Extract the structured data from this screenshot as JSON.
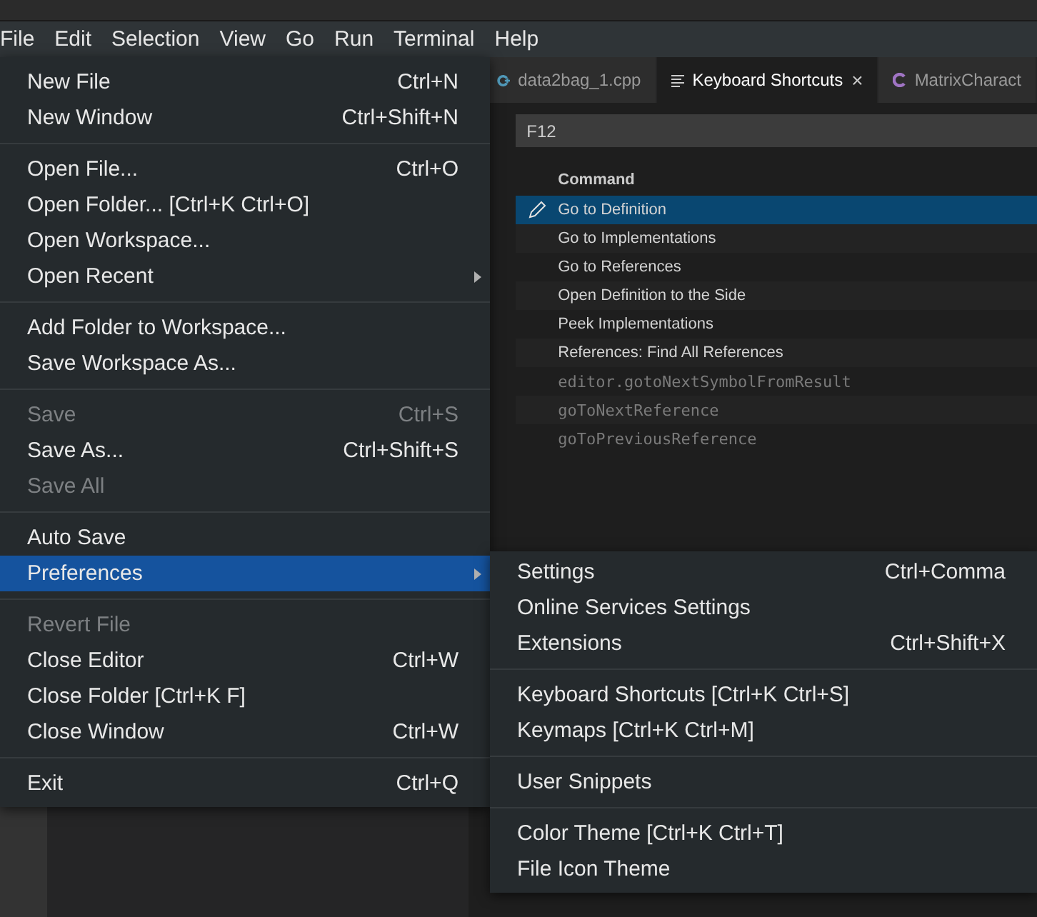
{
  "menubar": [
    {
      "label": "File"
    },
    {
      "label": "Edit"
    },
    {
      "label": "Selection"
    },
    {
      "label": "View"
    },
    {
      "label": "Go"
    },
    {
      "label": "Run"
    },
    {
      "label": "Terminal"
    },
    {
      "label": "Help"
    }
  ],
  "tabs": [
    {
      "label": "data2bag_1.cpp",
      "kind": "cpp",
      "selected": false
    },
    {
      "label": "Keyboard Shortcuts",
      "kind": "keybindings",
      "selected": true,
      "close": "×"
    },
    {
      "label": "MatrixCharact",
      "kind": "c",
      "selected": false
    }
  ],
  "search": {
    "value": "F12"
  },
  "table": {
    "columns": [
      "Command"
    ],
    "rows": [
      {
        "command": "Go to Definition",
        "kind": "label",
        "selected": true
      },
      {
        "command": "Go to Implementations",
        "kind": "label",
        "selected": false
      },
      {
        "command": "Go to References",
        "kind": "label",
        "selected": false
      },
      {
        "command": "Open Definition to the Side",
        "kind": "label",
        "selected": false
      },
      {
        "command": "Peek Implementations",
        "kind": "label",
        "selected": false
      },
      {
        "command": "References: Find All References",
        "kind": "label",
        "selected": false
      },
      {
        "command": "editor.gotoNextSymbolFromResult",
        "kind": "id",
        "selected": false
      },
      {
        "command": "goToNextReference",
        "kind": "id",
        "selected": false
      },
      {
        "command": "goToPreviousReference",
        "kind": "id",
        "selected": false
      }
    ]
  },
  "file_menu": {
    "groups": [
      [
        {
          "label": "New File",
          "shortcut": "Ctrl+N",
          "disabled": false,
          "selected": false,
          "submenu": false
        },
        {
          "label": "New Window",
          "shortcut": "Ctrl+Shift+N",
          "disabled": false,
          "selected": false,
          "submenu": false
        }
      ],
      [
        {
          "label": "Open File...",
          "shortcut": "Ctrl+O",
          "disabled": false,
          "selected": false,
          "submenu": false
        },
        {
          "label": "Open Folder... [Ctrl+K Ctrl+O]",
          "disabled": false,
          "selected": false,
          "submenu": false
        },
        {
          "label": "Open Workspace...",
          "disabled": false,
          "selected": false,
          "submenu": false
        },
        {
          "label": "Open Recent",
          "disabled": false,
          "selected": false,
          "submenu": true
        }
      ],
      [
        {
          "label": "Add Folder to Workspace...",
          "disabled": false,
          "selected": false,
          "submenu": false
        },
        {
          "label": "Save Workspace As...",
          "disabled": false,
          "selected": false,
          "submenu": false
        }
      ],
      [
        {
          "label": "Save",
          "shortcut": "Ctrl+S",
          "disabled": true,
          "selected": false,
          "submenu": false
        },
        {
          "label": "Save As...",
          "shortcut": "Ctrl+Shift+S",
          "disabled": false,
          "selected": false,
          "submenu": false
        },
        {
          "label": "Save All",
          "disabled": true,
          "selected": false,
          "submenu": false
        }
      ],
      [
        {
          "label": "Auto Save",
          "disabled": false,
          "selected": false,
          "submenu": false
        },
        {
          "label": "Preferences",
          "disabled": false,
          "selected": true,
          "submenu": true
        }
      ],
      [
        {
          "label": "Revert File",
          "disabled": true,
          "selected": false,
          "submenu": false
        },
        {
          "label": "Close Editor",
          "shortcut": "Ctrl+W",
          "disabled": false,
          "selected": false,
          "submenu": false
        },
        {
          "label": "Close Folder [Ctrl+K F]",
          "disabled": false,
          "selected": false,
          "submenu": false
        },
        {
          "label": "Close Window",
          "shortcut": "Ctrl+W",
          "disabled": false,
          "selected": false,
          "submenu": false
        }
      ],
      [
        {
          "label": "Exit",
          "shortcut": "Ctrl+Q",
          "disabled": false,
          "selected": false,
          "submenu": false
        }
      ]
    ]
  },
  "preferences_menu": {
    "groups": [
      [
        {
          "label": "Settings",
          "shortcut": "Ctrl+Comma"
        },
        {
          "label": "Online Services Settings"
        },
        {
          "label": "Extensions",
          "shortcut": "Ctrl+Shift+X"
        }
      ],
      [
        {
          "label": "Keyboard Shortcuts [Ctrl+K Ctrl+S]"
        },
        {
          "label": "Keymaps [Ctrl+K Ctrl+M]"
        }
      ],
      [
        {
          "label": "User Snippets"
        }
      ],
      [
        {
          "label": "Color Theme [Ctrl+K Ctrl+T]"
        },
        {
          "label": "File Icon Theme"
        }
      ]
    ]
  }
}
